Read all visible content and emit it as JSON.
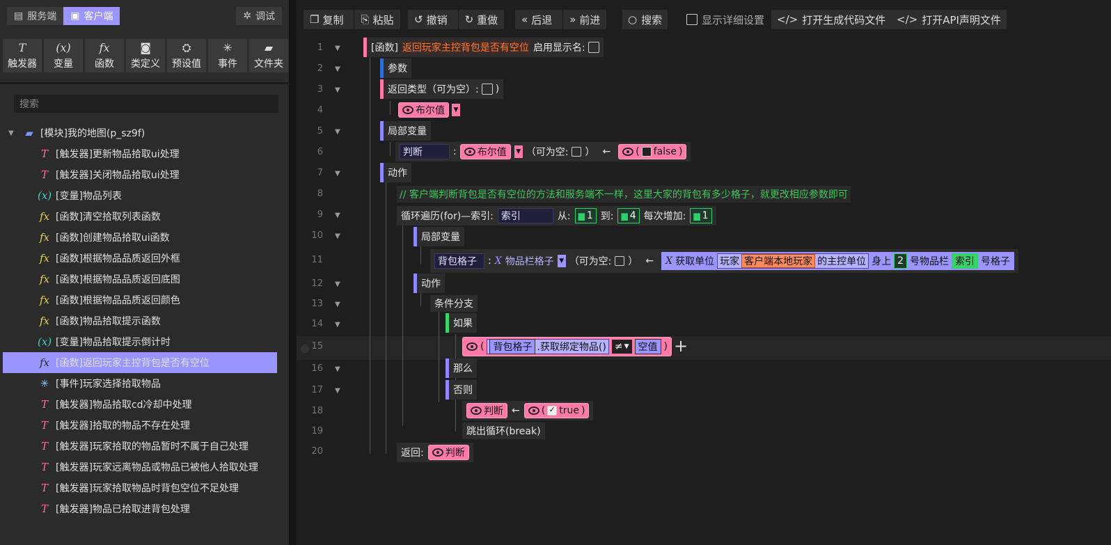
{
  "left": {
    "tabs": [
      {
        "label": "服务端",
        "icon": "server-icon"
      },
      {
        "label": "客户端",
        "icon": "client-icon"
      }
    ],
    "debug_label": "调试",
    "tools": [
      {
        "label": "触发器",
        "icon": "trigger-icon"
      },
      {
        "label": "变量",
        "icon": "variable-icon"
      },
      {
        "label": "函数",
        "icon": "function-icon"
      },
      {
        "label": "类定义",
        "icon": "class-icon"
      },
      {
        "label": "预设值",
        "icon": "preset-icon"
      },
      {
        "label": "事件",
        "icon": "event-icon"
      },
      {
        "label": "文件夹",
        "icon": "folder-icon"
      }
    ],
    "search_placeholder": "搜索",
    "tree_root": "[模块]我的地图(p_sz9f)",
    "tree_items": [
      {
        "type": "trigger",
        "label": "[触发器]更新物品拾取ui处理"
      },
      {
        "type": "trigger",
        "label": "[触发器]关闭物品拾取ui处理"
      },
      {
        "type": "var",
        "label": "[变量]物品列表"
      },
      {
        "type": "func",
        "label": "[函数]清空拾取列表函数"
      },
      {
        "type": "func",
        "label": "[函数]创建物品拾取ui函数"
      },
      {
        "type": "func",
        "label": "[函数]根据物品品质返回外框"
      },
      {
        "type": "func",
        "label": "[函数]根据物品品质返回底图"
      },
      {
        "type": "func",
        "label": "[函数]根据物品品质返回颜色"
      },
      {
        "type": "func",
        "label": "[函数]物品拾取提示函数"
      },
      {
        "type": "var",
        "label": "[变量]物品拾取提示倒计时"
      },
      {
        "type": "func",
        "label": "[函数]返回玩家主控背包是否有空位",
        "selected": true
      },
      {
        "type": "event",
        "label": "[事件]玩家选择拾取物品"
      },
      {
        "type": "trigger",
        "label": "[触发器]物品拾取cd冷却中处理"
      },
      {
        "type": "trigger",
        "label": "[触发器]拾取的物品不存在处理"
      },
      {
        "type": "trigger",
        "label": "[触发器]玩家拾取的物品暂时不属于自己处理"
      },
      {
        "type": "trigger",
        "label": "[触发器]玩家远离物品或物品已被他人拾取处理"
      },
      {
        "type": "trigger",
        "label": "[触发器]玩家拾取物品时背包空位不足处理"
      },
      {
        "type": "trigger",
        "label": "[触发器]物品已拾取进背包处理"
      }
    ]
  },
  "toolbar": {
    "copy": "复制",
    "paste": "粘贴",
    "undo": "撤销",
    "redo": "重做",
    "back": "后退",
    "forward": "前进",
    "search": "搜索",
    "show_detail": "显示详细设置",
    "open_code": "打开生成代码文件",
    "open_api": "打开API声明文件"
  },
  "code": {
    "line_numbers": [
      "1",
      "2",
      "3",
      "4",
      "5",
      "6",
      "7",
      "8",
      "9",
      "10",
      "11",
      "12",
      "13",
      "14",
      "15",
      "16",
      "17",
      "18",
      "19",
      "20"
    ],
    "l1_prefix": "[函数]",
    "l1_name": "返回玩家主控背包是否有空位",
    "l1_show_name": "启用显示名:",
    "l2": "参数",
    "l3": "返回类型（可为空）:",
    "l3_end": ")",
    "l4_type": "布尔值",
    "l5": "局部变量",
    "l6_name": "判断",
    "l6_colon": ":",
    "l6_type": "布尔值",
    "l6_nullable": "（可为空:",
    "l6_close": "）",
    "l6_arrow": "←",
    "l6_value": "false",
    "l7": "动作",
    "l8": "// 客户端判断背包是否有空位的方法和服务端不一样，这里大家的背包有多少格子，就更改相应参数即可",
    "l9_label": "循环遍历(for)—索引:",
    "l9_index": "索引",
    "l9_from": "从:",
    "l9_from_v": "1",
    "l9_to": "到:",
    "l9_to_v": "4",
    "l9_step": "每次增加:",
    "l9_step_v": "1",
    "l10": "局部变量",
    "l11_name": "背包格子",
    "l11_type": "物品栏格子",
    "l11_nullable": "（可为空:",
    "l11_close": "）",
    "l11_arrow": "←",
    "l11_get": "获取单位",
    "l11_player": "玩家",
    "l11_local": "客户端本地玩家",
    "l11_main": "的主控单位",
    "l11_on": "身上",
    "l11_num": "2",
    "l11_slot": "号物品栏",
    "l11_idx": "索引",
    "l11_grid": "号格子",
    "l12": "动作",
    "l13": "条件分支",
    "l14": "如果",
    "l15_var": "背包格子",
    "l15_method": ".获取绑定物品()",
    "l15_op": "≠",
    "l15_null": "空值",
    "l16": "那么",
    "l17": "否则",
    "l18_var": "判断",
    "l18_arrow": "←",
    "l18_value": "true",
    "l19": "跳出循环(break)",
    "l20_label": "返回:",
    "l20_var": "判断"
  }
}
